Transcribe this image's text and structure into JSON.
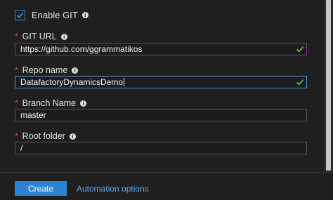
{
  "enable_git": {
    "label": "Enable GIT",
    "checked": true
  },
  "fields": [
    {
      "label": "GIT URL",
      "value": "https://github.com/ggrammatikos",
      "required": true,
      "valid": true
    },
    {
      "label": "Repo name",
      "value": "DatafactoryDynamicsDemo",
      "required": true,
      "valid": true,
      "focused": true
    },
    {
      "label": "Branch Name",
      "value": "master",
      "required": true
    },
    {
      "label": "Root folder",
      "value": "/",
      "required": true
    }
  ],
  "footer": {
    "create_label": "Create",
    "automation_label": "Automation options"
  },
  "colors": {
    "accent": "#2e83d5",
    "required": "#e0504f",
    "valid": "#6cc24a",
    "link": "#5aaaf0"
  }
}
